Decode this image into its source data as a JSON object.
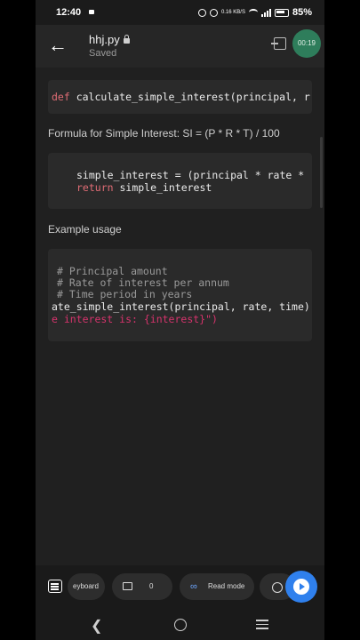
{
  "status": {
    "time": "12:40",
    "net_speed": "0.16 KB/S",
    "battery": "85%"
  },
  "header": {
    "title": "hhj.py",
    "subtitle": "Saved",
    "timer": "00:19"
  },
  "code1": {
    "kw": "def ",
    "text": "calculate_simple_interest(principal, r"
  },
  "formula_text": "Formula for Simple Interest: SI = (P * R * T) / 100",
  "code2": {
    "line1": "simple_interest = (principal * rate *",
    "line2_kw": "return ",
    "line2_text": "simple_interest"
  },
  "example_text": "Example usage",
  "code3": {
    "c1": "# Principal amount",
    "c2": "# Rate of interest per annum",
    "c3": "# Time period in years",
    "line4": "ate_simple_interest(principal, rate, time)",
    "line5": "e interest is: {interest}\")"
  },
  "toolbar": {
    "keyboard_label": "eyboard",
    "comment_count": "0",
    "read_mode_label": "Read mode"
  },
  "icons": [
    "back-arrow-icon",
    "lock-icon",
    "exit-icon",
    "list-icon",
    "comment-icon",
    "infinity-icon",
    "globe-icon",
    "play-icon"
  ]
}
